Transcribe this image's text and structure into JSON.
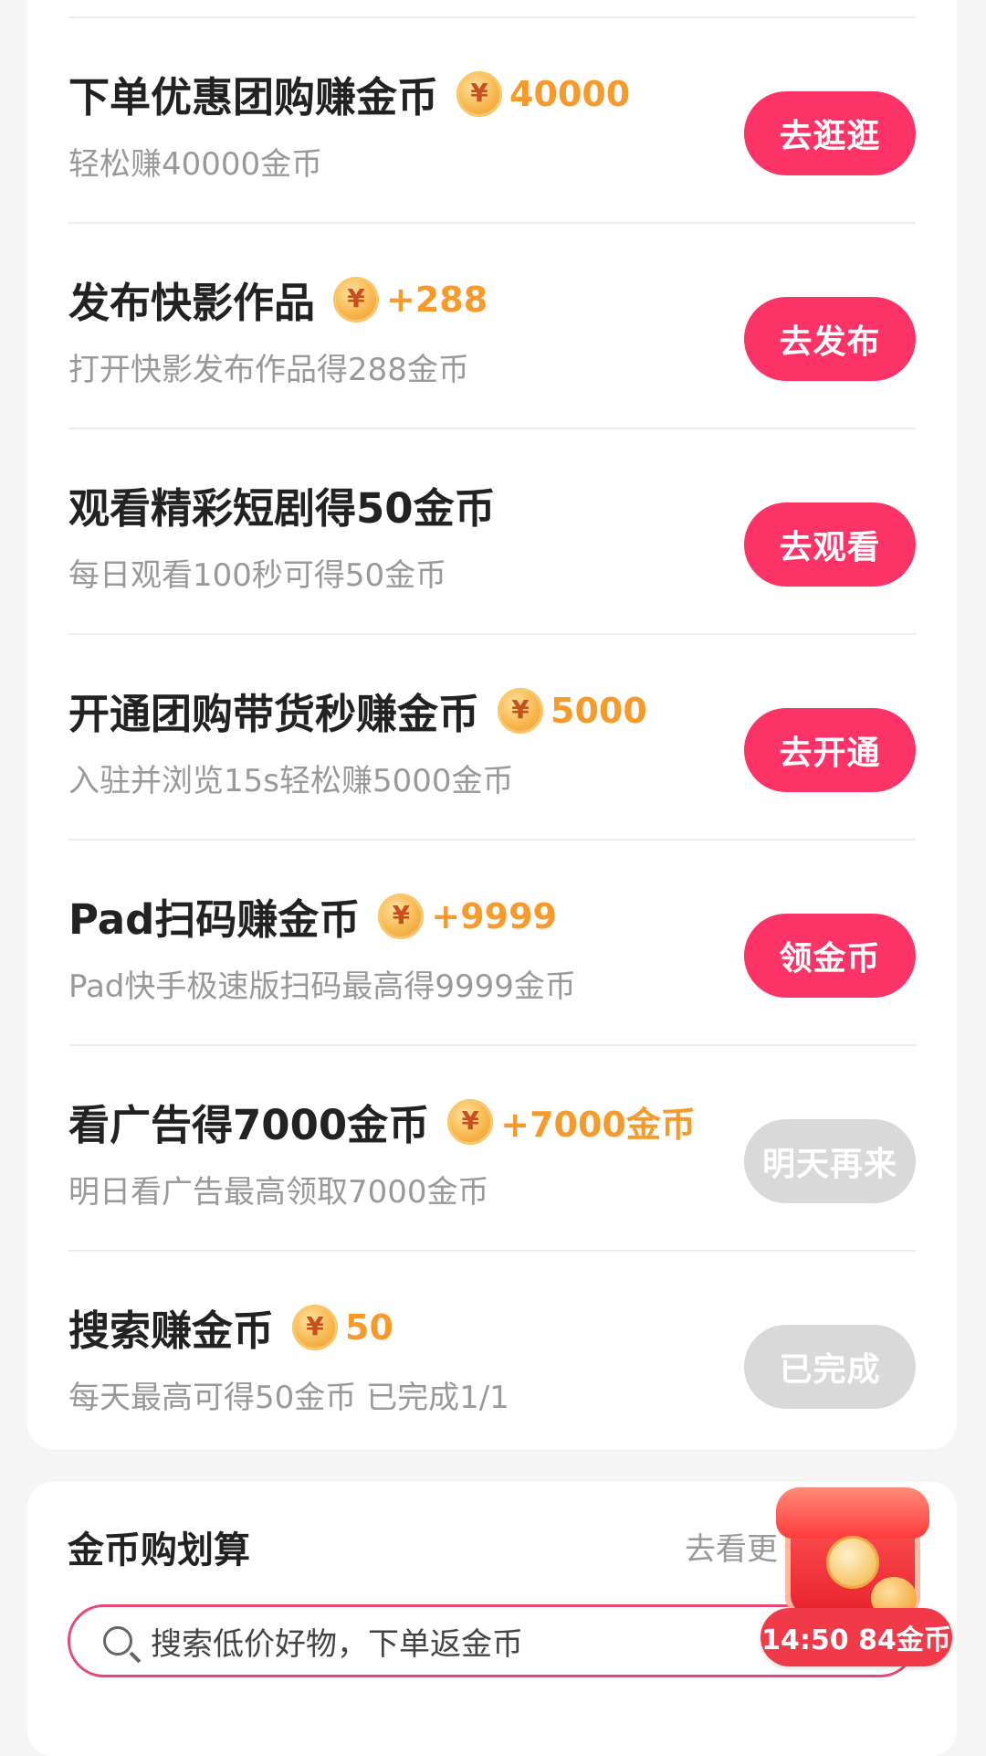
{
  "accent_color": "#fc3366",
  "reward_color": "#f59a2b",
  "disabled_color": "#d9d9d9",
  "tasks": [
    {
      "title": "下单优惠团购赚金币",
      "has_coin": true,
      "reward": "40000",
      "desc": "轻松赚40000金币",
      "button": "去逛逛",
      "button_disabled": false
    },
    {
      "title": "发布快影作品",
      "has_coin": true,
      "reward": "+288",
      "desc": "打开快影发布作品得288金币",
      "button": "去发布",
      "button_disabled": false
    },
    {
      "title": "观看精彩短剧得50金币",
      "has_coin": false,
      "reward": "",
      "desc": "每日观看100秒可得50金币",
      "button": "去观看",
      "button_disabled": false
    },
    {
      "title": "开通团购带货秒赚金币",
      "has_coin": true,
      "reward": "5000",
      "desc": "入驻并浏览15s轻松赚5000金币",
      "button": "去开通",
      "button_disabled": false
    },
    {
      "title": "Pad扫码赚金币",
      "has_coin": true,
      "reward": "+9999",
      "desc": "Pad快手极速版扫码最高得9999金币",
      "button": "领金币",
      "button_disabled": false
    },
    {
      "title": "看广告得7000金币",
      "has_coin": true,
      "reward": "+7000金币",
      "desc": "明日看广告最高领取7000金币",
      "button": "明天再来",
      "button_disabled": true
    },
    {
      "title": "搜索赚金币",
      "has_coin": true,
      "reward": "50",
      "desc": "每天最高可得50金币 已完成1/1",
      "button": "已完成",
      "button_disabled": true
    }
  ],
  "shop": {
    "title": "金币购划算",
    "more": "去看更",
    "search_placeholder": "搜索低价好物，下单返金币",
    "search_icon": "search-icon"
  },
  "floating": {
    "icon": "red-packet-icon",
    "timer_text": "14:50 84金币"
  }
}
